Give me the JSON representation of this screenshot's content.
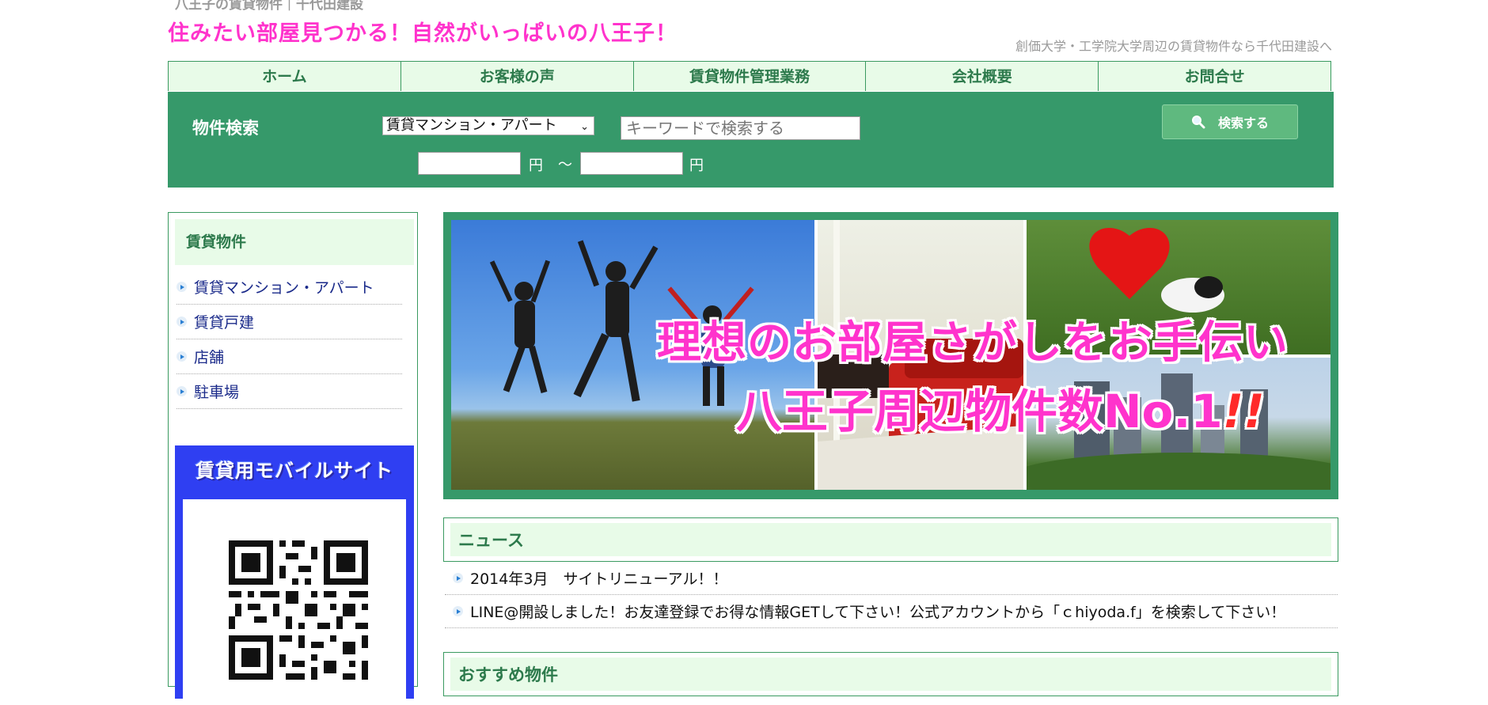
{
  "header": {
    "top_tag": "八王子の賃貸物件｜千代田建設",
    "tagline": "住みたい部屋見つかる！自然がいっぱいの八王子！",
    "right_text": "創価大学・工学院大学周辺の賃貸物件なら千代田建設へ"
  },
  "nav": {
    "items": [
      {
        "label": "ホーム"
      },
      {
        "label": "お客様の声"
      },
      {
        "label": "賃貸物件管理業務"
      },
      {
        "label": "会社概要"
      },
      {
        "label": "お問合せ"
      }
    ]
  },
  "search": {
    "title": "物件検索",
    "select_value": "賃貸マンション・アパート",
    "keyword_placeholder": "キーワードで検索する",
    "button_label": "検索する",
    "yen_label": "円",
    "range_separator": "～"
  },
  "sidebar": {
    "heading": "賃貸物件",
    "items": [
      {
        "label": "賃貸マンション・アパート"
      },
      {
        "label": "賃貸戸建"
      },
      {
        "label": "店舗"
      },
      {
        "label": "駐車場"
      }
    ],
    "mobile_title": "賃貸用モバイルサイト"
  },
  "banner": {
    "line1": "理想のお部屋さがしをお手伝い",
    "line2": "八王子周辺物件数No.1",
    "line2_mark": "!!"
  },
  "news": {
    "heading": "ニュース",
    "items": [
      {
        "text": "2014年3月　サイトリニューアル！！"
      },
      {
        "text": "LINE@開設しました！お友達登録でお得な情報GETして下さい！公式アカウントから「ｃhiyoda.f」を検索して下さい！"
      }
    ]
  },
  "recommend": {
    "heading": "おすすめ物件"
  },
  "colors": {
    "brand_green": "#36996a",
    "accent_pink": "#ff33cc",
    "light_green": "#e8fbe8",
    "mobile_blue": "#2f3ff2"
  },
  "icons": {
    "search_button": "magnifier-icon",
    "list_bullet": "arrow-bullet-icon",
    "select_toggle": "chevron-down-icon"
  }
}
